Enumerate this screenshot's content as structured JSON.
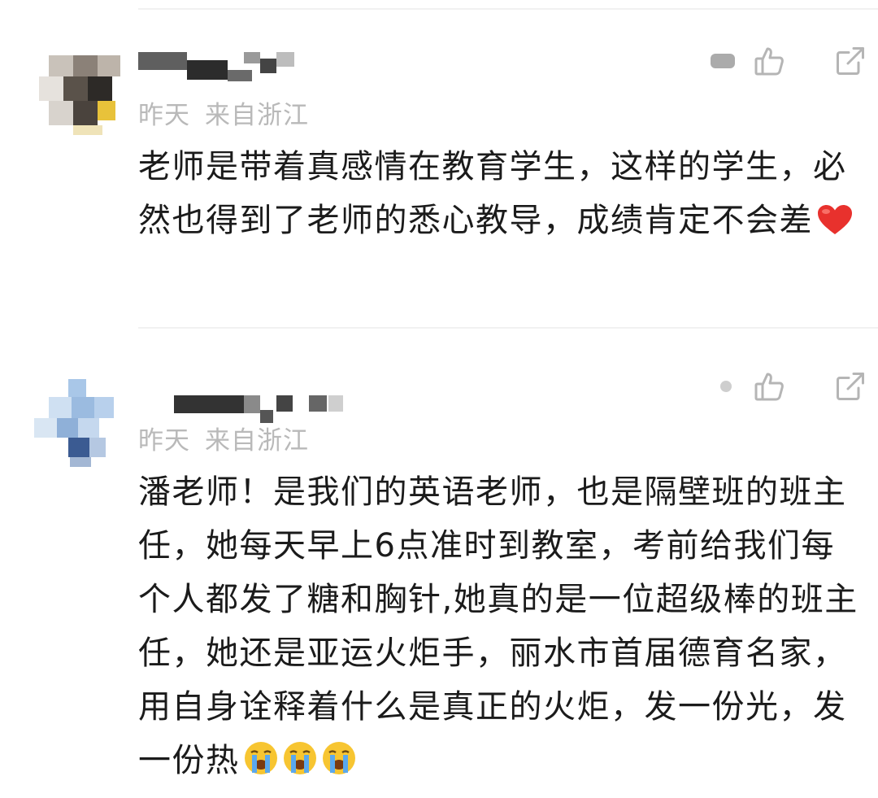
{
  "comments": [
    {
      "author": "",
      "time": "昨天",
      "location": "来自浙江",
      "text": "老师是带着真感情在教育学生，这样的学生，必然也得到了老师的悉心教导，成绩肯定不会差",
      "emoji": "red-heart",
      "actions": [
        "like-icon",
        "share-icon"
      ]
    },
    {
      "author": "",
      "time": "昨天",
      "location": "来自浙江",
      "text": "潘老师！是我们的英语老师，也是隔壁班的班主任，她每天早上6点准时到教室，考前给我们每个人都发了糖和胸针,她真的是一位超级棒的班主任，她还是亚运火炬手，丽水市首届德育名家，用自身诠释着什么是真正的火炬，发一份光，发一份热",
      "emoji": "crying-face",
      "emoji_count": 3,
      "actions": [
        "like-icon",
        "share-icon"
      ]
    }
  ]
}
